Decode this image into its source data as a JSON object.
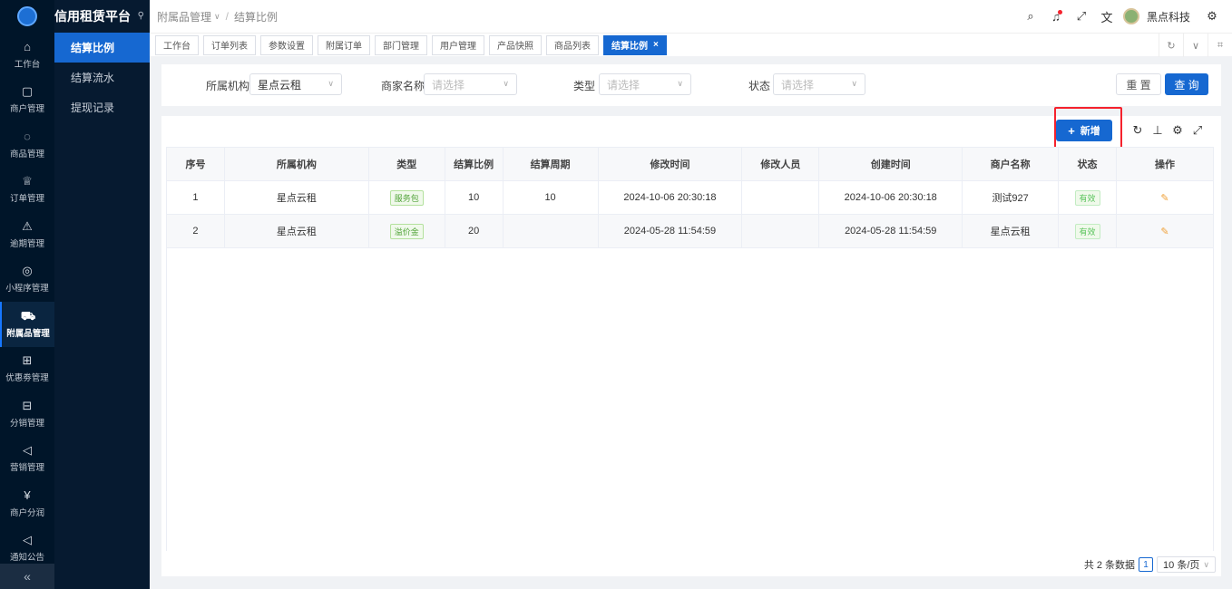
{
  "app": {
    "title": "信用租赁平台"
  },
  "rail": [
    {
      "label": "工作台",
      "icon": "home-icon",
      "glyph": "⌂"
    },
    {
      "label": "商户管理",
      "icon": "bag-icon",
      "glyph": "▢"
    },
    {
      "label": "商品管理",
      "icon": "apple-icon",
      "glyph": "◌"
    },
    {
      "label": "订单管理",
      "icon": "trophy-icon",
      "glyph": "♕"
    },
    {
      "label": "逾期管理",
      "icon": "alarm-icon",
      "glyph": "⚠"
    },
    {
      "label": "小程序管理",
      "icon": "chip-icon",
      "glyph": "◎"
    },
    {
      "label": "附属品管理",
      "icon": "cart-icon",
      "glyph": "⛟"
    },
    {
      "label": "优惠劵管理",
      "icon": "gift-icon",
      "glyph": "⊞"
    },
    {
      "label": "分销管理",
      "icon": "calculator-icon",
      "glyph": "⊟"
    },
    {
      "label": "营销管理",
      "icon": "megaphone-icon",
      "glyph": "◁"
    },
    {
      "label": "商户分润",
      "icon": "yen-icon",
      "glyph": "¥"
    },
    {
      "label": "通知公告",
      "icon": "notice-icon",
      "glyph": "◁"
    }
  ],
  "side_menu": [
    {
      "label": "结算比例",
      "active": true
    },
    {
      "label": "结算流水",
      "active": false
    },
    {
      "label": "提现记录",
      "active": false
    }
  ],
  "breadcrumb": {
    "parent": "附属品管理",
    "current": "结算比例"
  },
  "user": {
    "name": "黑点科技"
  },
  "tabs": [
    {
      "label": "工作台",
      "active": false
    },
    {
      "label": "订单列表",
      "active": false
    },
    {
      "label": "参数设置",
      "active": false
    },
    {
      "label": "附属订单",
      "active": false
    },
    {
      "label": "部门管理",
      "active": false
    },
    {
      "label": "用户管理",
      "active": false
    },
    {
      "label": "产品快照",
      "active": false
    },
    {
      "label": "商品列表",
      "active": false
    },
    {
      "label": "结算比例",
      "active": true
    }
  ],
  "filter": {
    "org_label": "所属机构",
    "org_value": "星点云租",
    "merchant_label": "商家名称",
    "merchant_placeholder": "请选择",
    "type_label": "类型",
    "type_placeholder": "请选择",
    "status_label": "状态",
    "status_placeholder": "请选择",
    "reset": "重 置",
    "query": "查 询"
  },
  "toolbar": {
    "add": "新增"
  },
  "table": {
    "headers": [
      "序号",
      "所属机构",
      "类型",
      "结算比例",
      "结算周期",
      "修改时间",
      "修改人员",
      "创建时间",
      "商户名称",
      "状态",
      "操作"
    ],
    "rows": [
      {
        "no": "1",
        "org": "星点云租",
        "type": "服务包",
        "ratio": "10",
        "cycle": "10",
        "modified": "2024-10-06 20:30:18",
        "modifier": "",
        "created": "2024-10-06 20:30:18",
        "merchant": "测试927",
        "status": "有效"
      },
      {
        "no": "2",
        "org": "星点云租",
        "type": "溢价金",
        "ratio": "20",
        "cycle": "",
        "modified": "2024-05-28 11:54:59",
        "modifier": "",
        "created": "2024-05-28 11:54:59",
        "merchant": "星点云租",
        "status": "有效"
      }
    ]
  },
  "pager": {
    "total": "共 2 条数据",
    "page": "1",
    "size": "10 条/页"
  },
  "colors": {
    "primary": "#1668d1",
    "sidebar": "#001529",
    "highlight": "#f5222d"
  }
}
